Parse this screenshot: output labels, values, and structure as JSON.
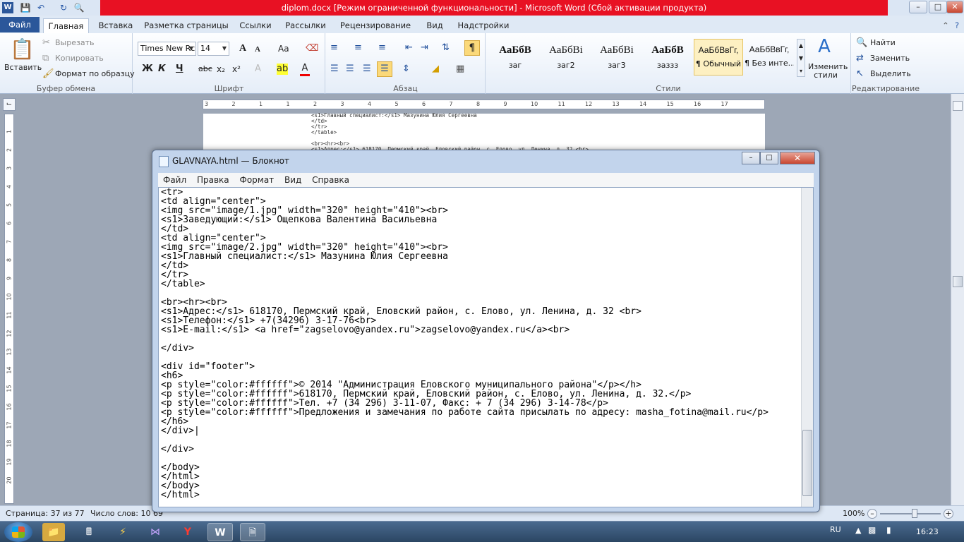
{
  "word": {
    "window_title": "diplom.docx [Режим ограниченной функциональности] - Microsoft Word (Сбой активации продукта)",
    "app_letter": "W",
    "qa_icons": [
      "save-icon",
      "undo-icon",
      "redo-icon",
      "print-preview-icon"
    ],
    "tabs": [
      "Файл",
      "Главная",
      "Вставка",
      "Разметка страницы",
      "Ссылки",
      "Рассылки",
      "Рецензирование",
      "Вид",
      "Надстройки"
    ],
    "active_tab": "Главная",
    "clipboard": {
      "paste": "Вставить",
      "cut": "Вырезать",
      "copy": "Копировать",
      "format_painter": "Формат по образцу",
      "label": "Буфер обмена"
    },
    "font": {
      "name": "Times New Rc",
      "size": "14",
      "label": "Шрифт",
      "bold": "Ж",
      "italic": "К",
      "underline": "Ч",
      "strike": "abc",
      "sub": "x₂",
      "sup": "x²",
      "grow": "A",
      "shrink": "A",
      "case": "Aa"
    },
    "paragraph": {
      "label": "Абзац",
      "pilcrow": "¶"
    },
    "styles": {
      "label": "Стили",
      "items": [
        {
          "preview": "АаБбВ",
          "name": "заг"
        },
        {
          "preview": "АаБбВі",
          "name": "заг2"
        },
        {
          "preview": "АаБбВі",
          "name": "заг3"
        },
        {
          "preview": "АаБбВ",
          "name": "заззз"
        },
        {
          "preview": "АаБбВвГг,",
          "name": "¶ Обычный"
        },
        {
          "preview": "АаБбВвГг,",
          "name": "¶ Без инте..."
        }
      ],
      "change": "Изменить стили"
    },
    "editing": {
      "find": "Найти",
      "replace": "Заменить",
      "select": "Выделить",
      "label": "Редактирование"
    },
    "ruler_marks": [
      "3",
      "2",
      "1",
      "1",
      "2",
      "3",
      "4",
      "5",
      "6",
      "7",
      "8",
      "9",
      "10",
      "11",
      "12",
      "13",
      "14",
      "15",
      "16",
      "17"
    ],
    "vruler_marks": [
      "1",
      "2",
      "3",
      "4",
      "5",
      "6",
      "7",
      "8",
      "9",
      "10",
      "11",
      "12",
      "13",
      "14",
      "15",
      "16",
      "17",
      "18",
      "19",
      "20"
    ],
    "doc_snippet": "<s1>Главный специалист:</s1> Мазунина Юлия Сергеевна\n</td>\n</tr>\n</table>\n\n<br><hr><br>\n<s1>Адрес:</s1> 618170, Пермский край, Еловский район, с. Елово, ул. Ленина, д. 32 <br>",
    "status": {
      "page": "Страница: 37 из 77",
      "words": "Число слов: 10 69",
      "zoom": "100%"
    }
  },
  "notepad": {
    "title": "GLAVNAYA.html — Блокнот",
    "menu": [
      "Файл",
      "Правка",
      "Формат",
      "Вид",
      "Справка"
    ],
    "lines": [
      "<tr>",
      "<td align=\"center\">",
      "<img src=\"image/1.jpg\" width=\"320\" height=\"410\"><br>",
      "<s1>Заведующий:</s1> Ощепкова Валентина Васильевна",
      "</td>",
      "<td align=\"center\">",
      "<img src=\"image/2.jpg\" width=\"320\" height=\"410\"><br>",
      "<s1>Главный специалист:</s1> Мазунина Юлия Сергеевна",
      "</td>",
      "</tr>",
      "</table>",
      "",
      "<br><hr><br>",
      "<s1>Адрес:</s1> 618170, Пермский край, Еловский район, с. Елово, ул. Ленина, д. 32 <br>",
      "<s1>Телефон:</s1> +7(34296) 3-17-76<br>",
      "<s1>E-mail:</s1> <a href=\"zagselovo@yandex.ru\">zagselovo@yandex.ru</a><br>",
      "",
      "</div>",
      "",
      "<div id=\"footer\">",
      "<h6>",
      "<p style=\"color:#ffffff\">© 2014 \"Администрация Еловского муниципального района\"</p></h>",
      "<p style=\"color:#ffffff\">618170, Пермский край, Еловский район, с. Елово, ул. Ленина, д. 32.</p>",
      "<p style=\"color:#ffffff\">Тел. +7 (34 296) 3-11-07, Факс: + 7 (34 296) 3-14-78</p>",
      "<p style=\"color:#ffffff\">Предложения и замечания по работе сайта присылать по адресу: masha_fotina@mail.ru</p>",
      "</h6>",
      "</div>|",
      "",
      "</div>",
      "",
      "</body>",
      "</html>",
      "</body>",
      "</html>"
    ]
  },
  "taskbar": {
    "lang": "RU",
    "time": "16:23",
    "apps": [
      "explorer-icon",
      "calculator-icon",
      "winamp-icon",
      "visual-studio-icon",
      "yandex-icon",
      "word-icon",
      "notepad-icon"
    ]
  },
  "colors": {
    "title_bar_error": "#e81123",
    "file_tab": "#2b579a",
    "taskbar": "#2b4663"
  }
}
